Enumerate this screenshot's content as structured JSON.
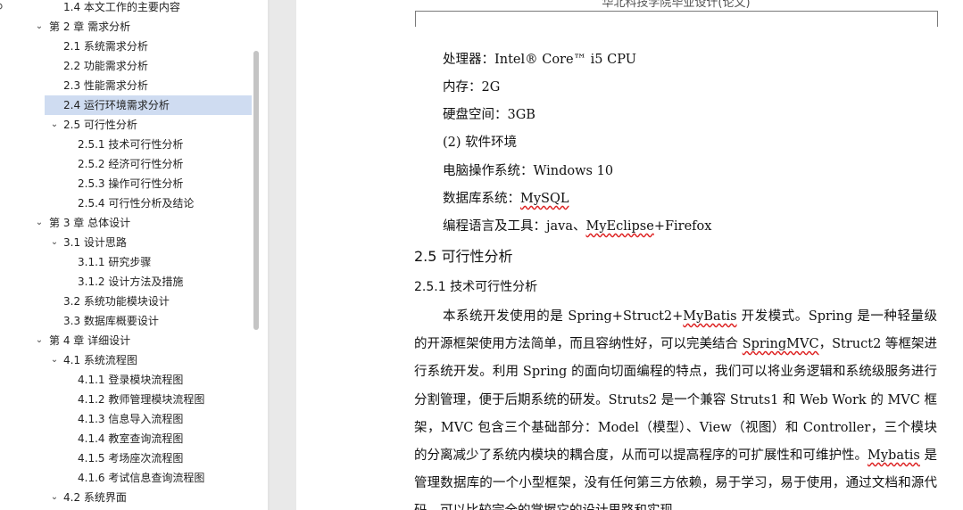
{
  "navigation": {
    "items": [
      {
        "label": "1.4 本文工作的主要内容",
        "level": 1,
        "expanded": null,
        "selected": false
      },
      {
        "label": "第 2 章  需求分析",
        "level": 0,
        "expanded": true,
        "selected": false
      },
      {
        "label": "2.1 系统需求分析",
        "level": 1,
        "expanded": null,
        "selected": false
      },
      {
        "label": "2.2 功能需求分析",
        "level": 1,
        "expanded": null,
        "selected": false
      },
      {
        "label": "2.3 性能需求分析",
        "level": 1,
        "expanded": null,
        "selected": false
      },
      {
        "label": "2.4 运行环境需求分析",
        "level": 1,
        "expanded": null,
        "selected": true
      },
      {
        "label": "2.5 可行性分析",
        "level": 1,
        "expanded": true,
        "selected": false
      },
      {
        "label": "2.5.1 技术可行性分析",
        "level": 2,
        "expanded": null,
        "selected": false
      },
      {
        "label": "2.5.2 经济可行性分析",
        "level": 2,
        "expanded": null,
        "selected": false
      },
      {
        "label": "2.5.3 操作可行性分析",
        "level": 2,
        "expanded": null,
        "selected": false
      },
      {
        "label": "2.5.4 可行性分析及结论",
        "level": 2,
        "expanded": null,
        "selected": false
      },
      {
        "label": "第 3 章  总体设计",
        "level": 0,
        "expanded": true,
        "selected": false
      },
      {
        "label": "3.1 设计思路",
        "level": 1,
        "expanded": true,
        "selected": false
      },
      {
        "label": "3.1.1 研究步骤",
        "level": 2,
        "expanded": null,
        "selected": false
      },
      {
        "label": "3.1.2 设计方法及措施",
        "level": 2,
        "expanded": null,
        "selected": false
      },
      {
        "label": "3.2 系统功能模块设计",
        "level": 1,
        "expanded": null,
        "selected": false
      },
      {
        "label": "3.3 数据库概要设计",
        "level": 1,
        "expanded": null,
        "selected": false
      },
      {
        "label": "第 4 章  详细设计",
        "level": 0,
        "expanded": true,
        "selected": false
      },
      {
        "label": "4.1 系统流程图",
        "level": 1,
        "expanded": true,
        "selected": false
      },
      {
        "label": "4.1.1 登录模块流程图",
        "level": 2,
        "expanded": null,
        "selected": false
      },
      {
        "label": "4.1.2 教师管理模块流程图",
        "level": 2,
        "expanded": null,
        "selected": false
      },
      {
        "label": "4.1.3 信息导入流程图",
        "level": 2,
        "expanded": null,
        "selected": false
      },
      {
        "label": "4.1.4 教室查询流程图",
        "level": 2,
        "expanded": null,
        "selected": false
      },
      {
        "label": "4.1.5 考场座次流程图",
        "level": 2,
        "expanded": null,
        "selected": false
      },
      {
        "label": "4.1.6 考试信息查询流程图",
        "level": 2,
        "expanded": null,
        "selected": false
      },
      {
        "label": "4.2 系统界面",
        "level": 1,
        "expanded": true,
        "selected": false
      }
    ]
  },
  "icons": {
    "search": "search-icon",
    "expanded": "chevron-down-icon"
  },
  "colors": {
    "selected_bg": "#cfdcf1",
    "spellcheck_underline": "#dd2222",
    "canvas_bg": "#e9e9e9"
  },
  "document": {
    "header": "华北科技学院毕业设计(论文)",
    "lines": {
      "cpu": {
        "before": "处理器：Intel® Core™   i5 CPU"
      },
      "ram": {
        "before": "内存：2G"
      },
      "disk": {
        "before": "硬盘空间：3GB"
      },
      "software": {
        "before": "(2) 软件环境"
      },
      "os": {
        "before": "电脑操作系统：Windows 10"
      },
      "db": {
        "before": "数据库系统：",
        "flag": "MySQL"
      },
      "tools": {
        "before": "编程语言及工具：java、",
        "flag": "MyEclipse",
        "after": "+Firefox"
      }
    },
    "section_heading": "2.5 可行性分析",
    "subsection_heading": "2.5.1 技术可行性分析",
    "paragraph1": {
      "a": "本系统开发使用的是 Spring+Struct2+",
      "b": "MyBatis",
      "c": " 开发模式。Spring 是一种轻量级的开源框架使用方法简单，而且容纳性好，可以完美结合 ",
      "d": "SpringMVC",
      "e": "，Struct2 等框架进行系统开发。利用 Spring 的面向切面编程的特点，我们可以将业务逻辑和系统级服务进行分割管理，便于后期系统的研发。Struts2 是一个兼容 Struts1 和 Web Work 的 MVC 框架，MVC 包含三个基础部分：Model（模型）、View（视图）和 Controller，三个模块的分离减少了系统内模块的耦合度，从而可以提高程序的可扩展性和可维护性。",
      "f": "Mybatis",
      "g": " 是管理数据库的一个小型框架，没有任何第三方依赖，易于学习，易于使用，通过文档和源代码，可以比较完全的掌握它的设计思路和实现。"
    }
  }
}
